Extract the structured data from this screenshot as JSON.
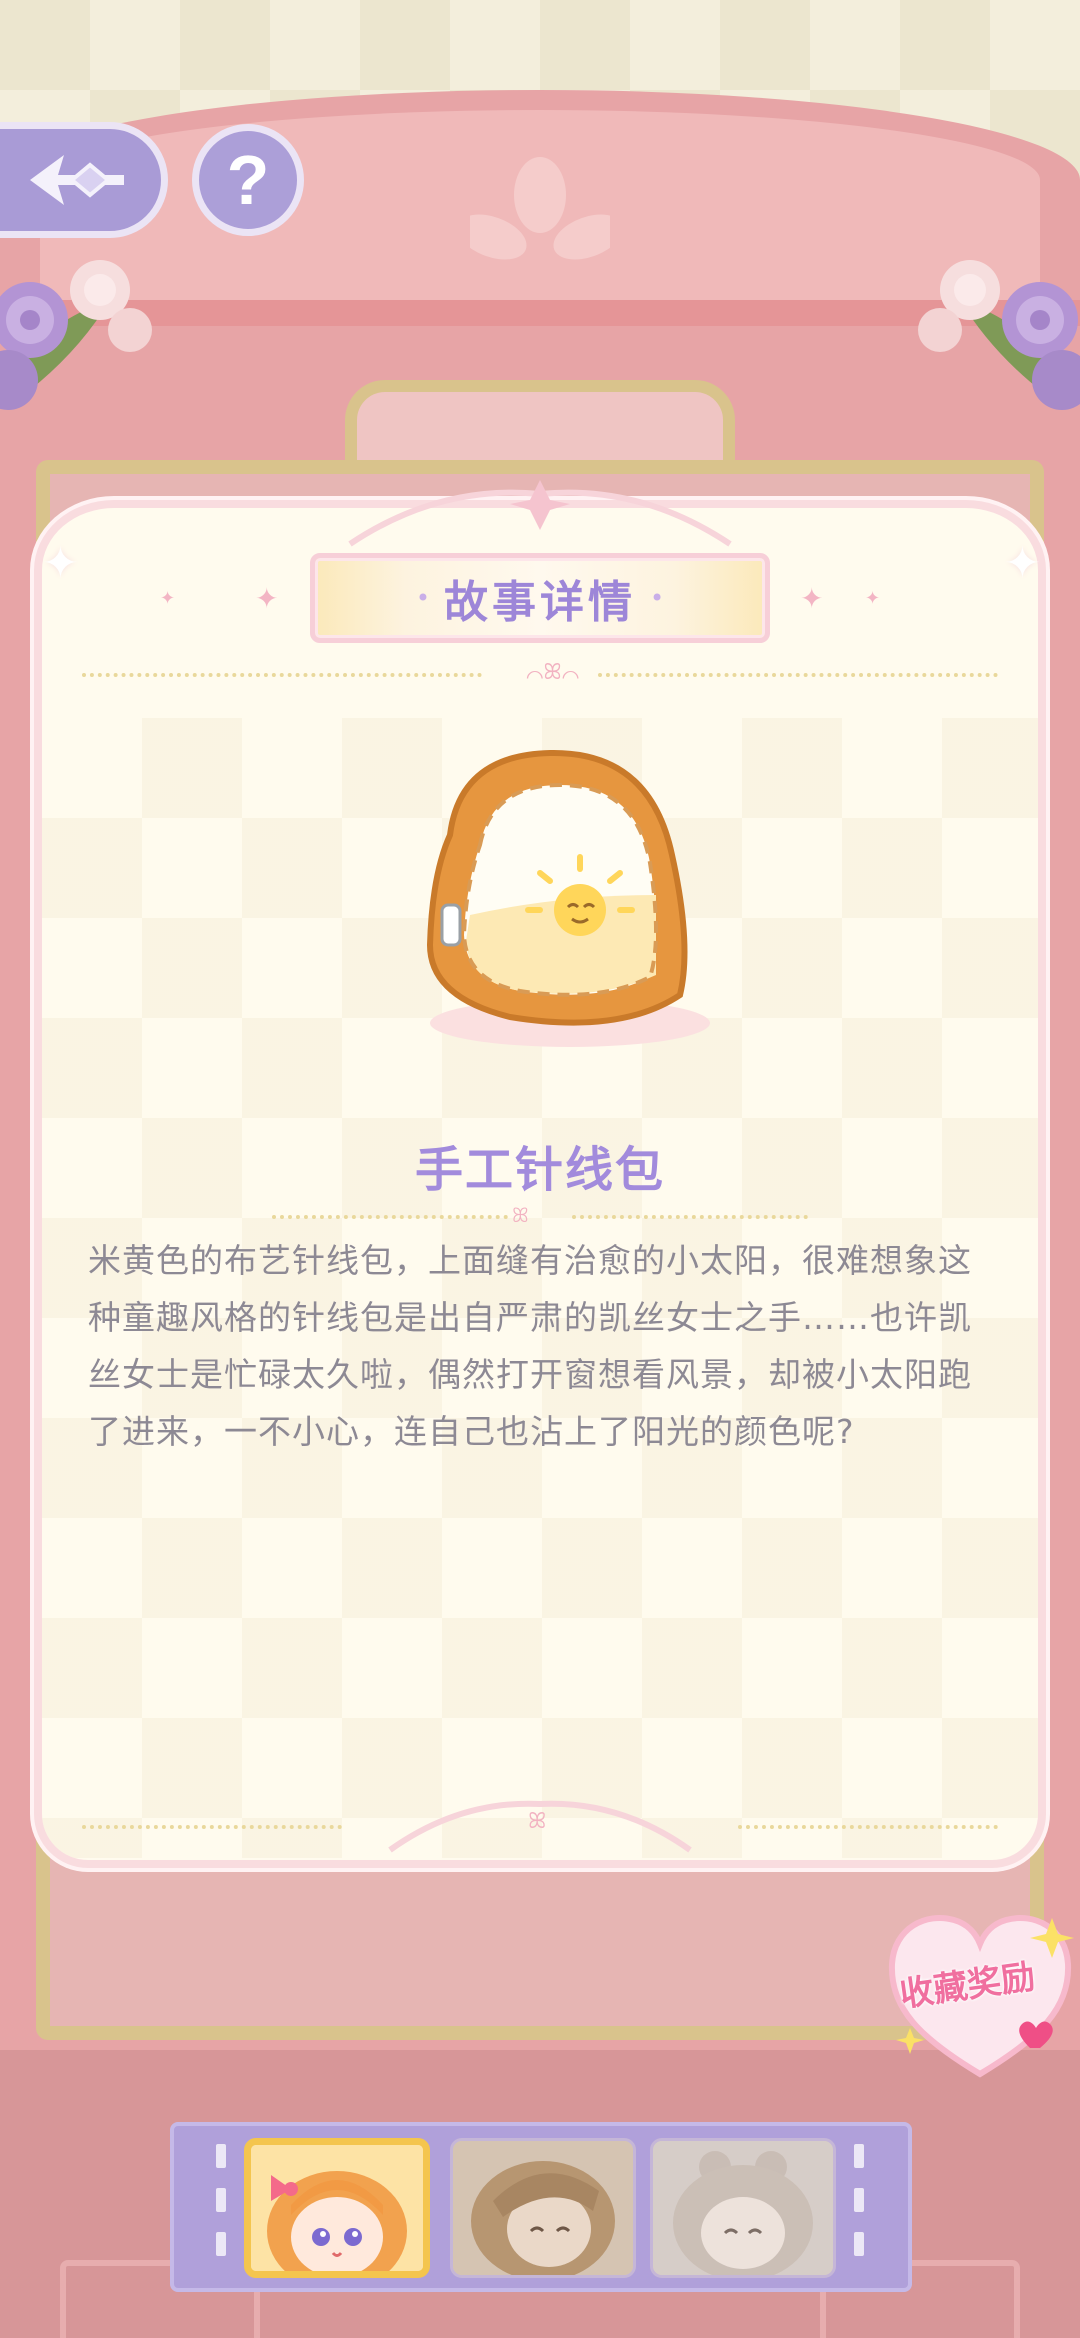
{
  "header": {
    "back_icon": "ornate-arrow-left-icon",
    "help_label": "?"
  },
  "card": {
    "title": "故事详情",
    "item": {
      "name": "手工针线包",
      "image": "orange-sewing-pouch-with-sun",
      "description": "米黄色的布艺针线包，上面缝有治愈的小太阳，很难想象这种童趣风格的针线包是出自严肃的凯丝女士之手……也许凯丝女士是忙碌太久啦，偶然打开窗想看风景，却被小太阳跑了进来，一不小心，连自己也沾上了阳光的颜色呢?"
    }
  },
  "reward": {
    "label": "收藏奖励",
    "icon": "heart-badge-icon"
  },
  "characters": [
    {
      "name": "character-orange-hair-girl",
      "selected": true
    },
    {
      "name": "character-brown-hair-girl",
      "selected": false
    },
    {
      "name": "character-gray-hair-girl",
      "selected": false
    }
  ],
  "colors": {
    "accent_purple": "#a28bdc",
    "cabinet_pink": "#e7a4a6",
    "card_bg": "#fffbee",
    "reward_pink": "#f06f9f"
  }
}
